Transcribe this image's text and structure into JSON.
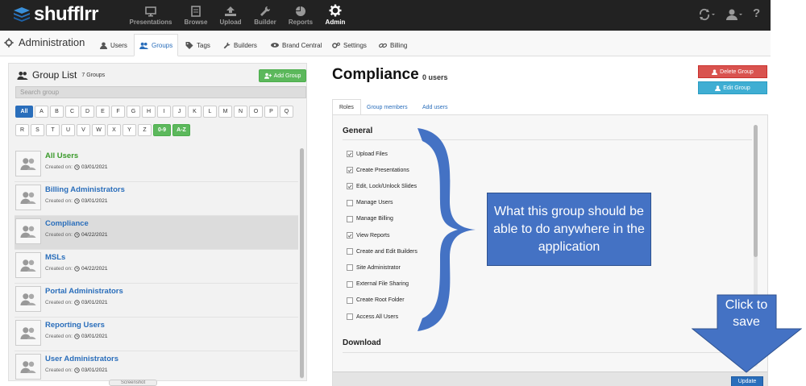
{
  "app": {
    "name": "shufflrr"
  },
  "nav": {
    "items": [
      {
        "label": "Presentations",
        "icon": "monitor-icon"
      },
      {
        "label": "Browse",
        "icon": "document-icon"
      },
      {
        "label": "Upload",
        "icon": "upload-icon"
      },
      {
        "label": "Builder",
        "icon": "wrench-icon"
      },
      {
        "label": "Reports",
        "icon": "pie-chart-icon"
      },
      {
        "label": "Admin",
        "icon": "gear-icon"
      }
    ],
    "active": "Admin",
    "help_label": "?"
  },
  "admin": {
    "title": "Administration",
    "tabs": [
      {
        "label": "Users"
      },
      {
        "label": "Groups"
      },
      {
        "label": "Tags"
      },
      {
        "label": "Builders"
      },
      {
        "label": "Brand Central"
      },
      {
        "label": "Settings"
      },
      {
        "label": "Billing"
      }
    ],
    "active_tab": "Groups"
  },
  "group_list": {
    "title": "Group List",
    "count": "7 Groups",
    "add_button": "Add Group",
    "search_placeholder": "Search group",
    "letters_row1": [
      "All",
      "A",
      "B",
      "C",
      "D",
      "E",
      "F",
      "G",
      "H",
      "I",
      "J",
      "K",
      "L",
      "M",
      "N",
      "O",
      "P",
      "Q"
    ],
    "letters_row2": [
      "R",
      "S",
      "T",
      "U",
      "V",
      "W",
      "X",
      "Y",
      "Z",
      "0-9",
      "A-Z"
    ],
    "created_label": "Created on:",
    "groups": [
      {
        "name": "All Users",
        "created": "03/01/2021"
      },
      {
        "name": "Billing Administrators",
        "created": "03/01/2021"
      },
      {
        "name": "Compliance",
        "created": "04/22/2021"
      },
      {
        "name": "MSLs",
        "created": "04/22/2021"
      },
      {
        "name": "Portal Administrators",
        "created": "03/01/2021"
      },
      {
        "name": "Reporting Users",
        "created": "03/01/2021"
      },
      {
        "name": "User Administrators",
        "created": "03/01/2021"
      }
    ],
    "selected": "Compliance",
    "screenshot_tag": "Screenshot"
  },
  "group_detail": {
    "name": "Compliance",
    "users": "0 users",
    "delete_button": "Delete Group",
    "edit_button": "Edit Group",
    "tabs": [
      {
        "label": "Roles"
      },
      {
        "label": "Group members"
      },
      {
        "label": "Add users"
      }
    ],
    "active_tab": "Roles",
    "section_general": "General",
    "permissions": [
      {
        "label": "Upload Files",
        "checked": true
      },
      {
        "label": "Create Presentations",
        "checked": true
      },
      {
        "label": "Edit, Lock/Unlock Slides",
        "checked": true
      },
      {
        "label": "Manage Users",
        "checked": false
      },
      {
        "label": "Manage Billing",
        "checked": false
      },
      {
        "label": "View Reports",
        "checked": true
      },
      {
        "label": "Create and Edit Builders",
        "checked": false
      },
      {
        "label": "Site Administrator",
        "checked": false
      },
      {
        "label": "External File Sharing",
        "checked": false
      },
      {
        "label": "Create Root Folder",
        "checked": false
      },
      {
        "label": "Access All Users",
        "checked": false
      }
    ],
    "section_download": "Download",
    "update_button": "Update"
  },
  "annotations": {
    "callout": "What this group should be able to do anywhere in the application",
    "arrow_text": "Click to save"
  },
  "colors": {
    "nav_bg": "#222222",
    "accent_blue": "#2a6ebb",
    "green": "#5cb85c",
    "danger": "#d9534f",
    "info": "#3faed3",
    "annotation_blue": "#4472c4"
  }
}
